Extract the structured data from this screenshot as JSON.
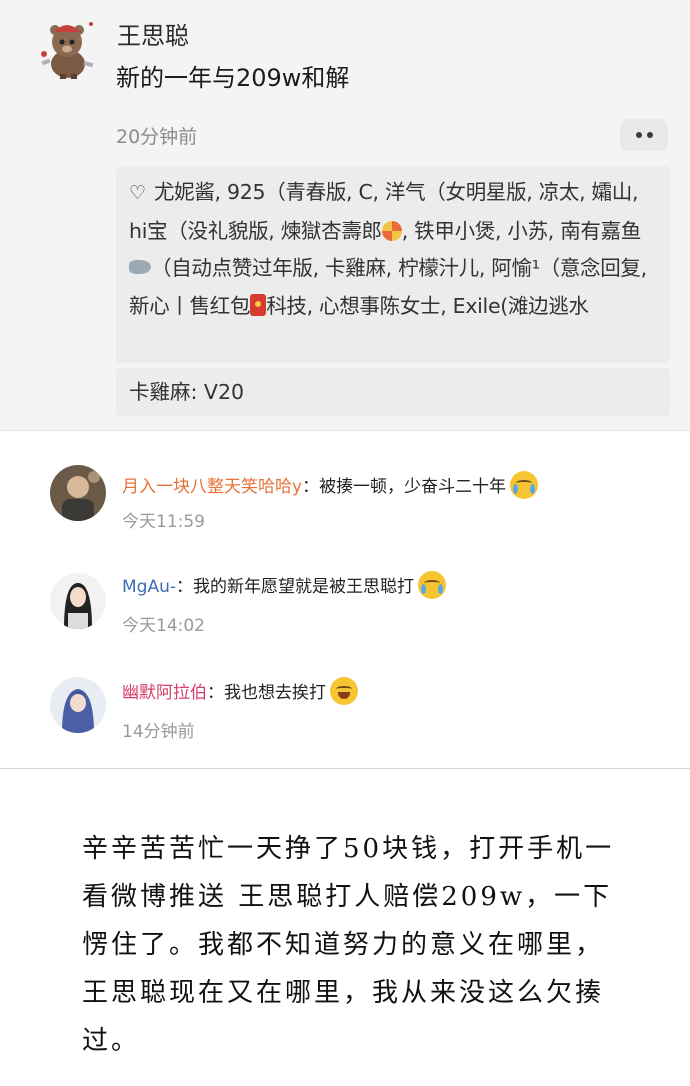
{
  "post": {
    "author": "王思聪",
    "text": "新的一年与209w和解",
    "time": "20分钟前",
    "likes_text_1": "尤妮酱, 925（青春版, C, 洋气（女明星版, 凉太, 孀山, hi宝（没礼貌版, 煉獄杏壽郎",
    "likes_text_2": ", 铁甲小煲, 小苏, 南有嘉鱼",
    "likes_text_3": "（自动点赞过年版, 卡雞麻, 柠檬汁儿, 阿愉¹（意念回复, 新心丨售红包",
    "likes_text_4": "科技, 心想事陈女士, Exile(滩边逃水",
    "reply": "卡雞麻: V20",
    "icons": {
      "heart": "heart-icon",
      "pinwheel": "pinwheel-emoji-icon",
      "fish": "fish-emoji-icon",
      "redpacket": "red-packet-emoji-icon",
      "more": "more-dots-icon"
    }
  },
  "comments": [
    {
      "user": "月入一块八整天笑哈哈y",
      "sep": "：",
      "text": "被揍一顿，少奋斗二十年",
      "emoji": "crying-face-icon",
      "time": "今天11:59"
    },
    {
      "user": "MgAu-",
      "sep": "：",
      "text": "我的新年愿望就是被王思聪打",
      "emoji": "crying-face-icon",
      "time": "今天14:02"
    },
    {
      "user": "幽默阿拉伯",
      "sep": "：",
      "text": "我也想去挨打",
      "emoji": "laughing-tears-face-icon",
      "time": "14分钟前"
    }
  ],
  "note": {
    "text": "辛辛苦苦忙一天挣了50块钱，打开手机一看微博推送 王思聪打人赔偿209w，一下愣住了。我都不知道努力的意义在哪里，王思聪现在又在哪里，我从来没这么欠揍过。"
  },
  "colors": {
    "post_bg": "#f4f4f4",
    "box_bg": "#ececec",
    "user_orange": "#e8733a",
    "user_blue": "#3d6fb5",
    "user_pink": "#d4406a",
    "meta_grey": "#9a9a9a"
  }
}
